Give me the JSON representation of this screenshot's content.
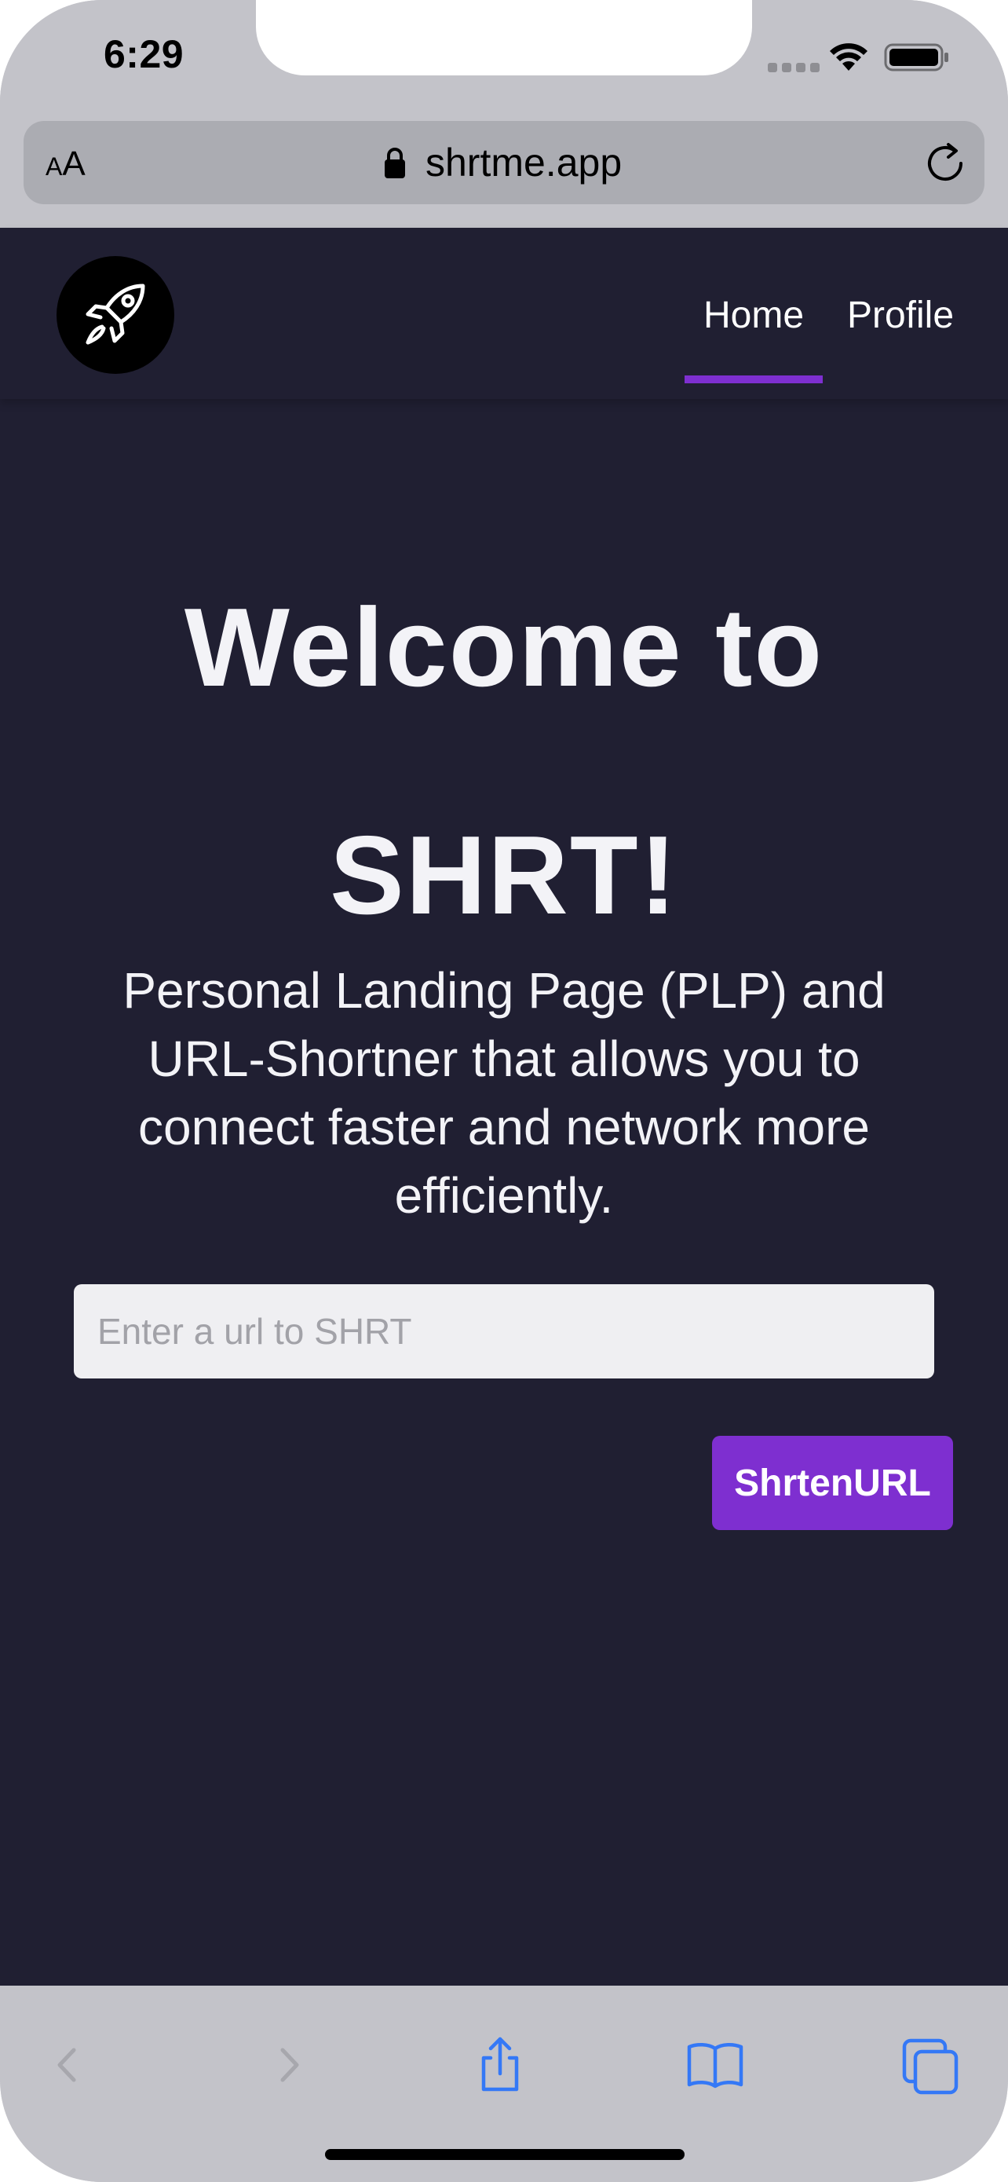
{
  "status_bar": {
    "time": "6:29"
  },
  "browser": {
    "text_size_label": "AA",
    "domain": "shrtme.app"
  },
  "navbar": {
    "logo": "rocket-icon",
    "items": [
      {
        "label": "Home",
        "active": true
      },
      {
        "label": "Profile",
        "active": false
      }
    ],
    "accent_color": "#7e2fd0"
  },
  "hero": {
    "title_line1": "Welcome to",
    "title_line2": "SHRT!",
    "description": "Personal Landing Page (PLP) and URL-Shortner that allows you to connect faster and network more efficiently."
  },
  "form": {
    "url_input": {
      "value": "",
      "placeholder": "Enter a url to SHRT"
    },
    "submit_label": "ShrtenURL"
  },
  "toolbar": {
    "icons": [
      "back-icon",
      "forward-icon",
      "share-icon",
      "bookmarks-icon",
      "tabs-icon"
    ]
  },
  "colors": {
    "page_background": "#201f32",
    "accent": "#7e2fd0",
    "browser_chrome": "#c3c3c9",
    "toolbar_icon": "#3478f6"
  }
}
